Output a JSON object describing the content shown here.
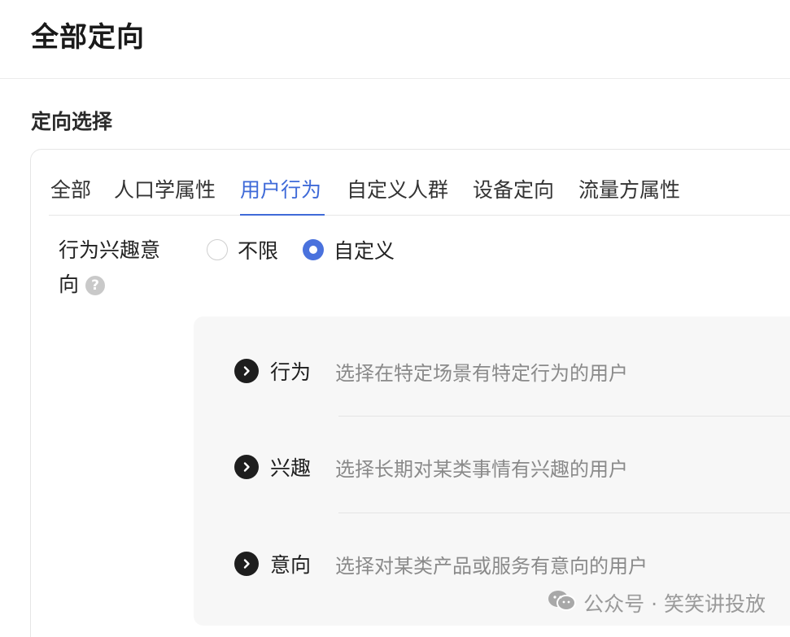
{
  "header": {
    "title": "全部定向"
  },
  "section": {
    "title": "定向选择"
  },
  "tabs": [
    {
      "label": "全部"
    },
    {
      "label": "人口学属性"
    },
    {
      "label": "用户行为",
      "active": true
    },
    {
      "label": "自定义人群"
    },
    {
      "label": "设备定向"
    },
    {
      "label": "流量方属性"
    }
  ],
  "field": {
    "label_line1": "行为兴趣意",
    "label_line2": "向",
    "help_icon": "?"
  },
  "radio": {
    "options": [
      {
        "label": "不限",
        "checked": false
      },
      {
        "label": "自定义",
        "checked": true
      }
    ]
  },
  "options": [
    {
      "name": "行为",
      "desc": "选择在特定场景有特定行为的用户"
    },
    {
      "name": "兴趣",
      "desc": "选择长期对某类事情有兴趣的用户"
    },
    {
      "name": "意向",
      "desc": "选择对某类产品或服务有意向的用户"
    }
  ],
  "watermark": {
    "text": "公众号 · 笑笑讲投放"
  },
  "colors": {
    "accent": "#3f6ad8",
    "radio_checked": "#4a72dd"
  },
  "icons": {
    "chevron": "chevron-right-icon",
    "help": "help-icon",
    "watermark": "wechat-icon"
  }
}
